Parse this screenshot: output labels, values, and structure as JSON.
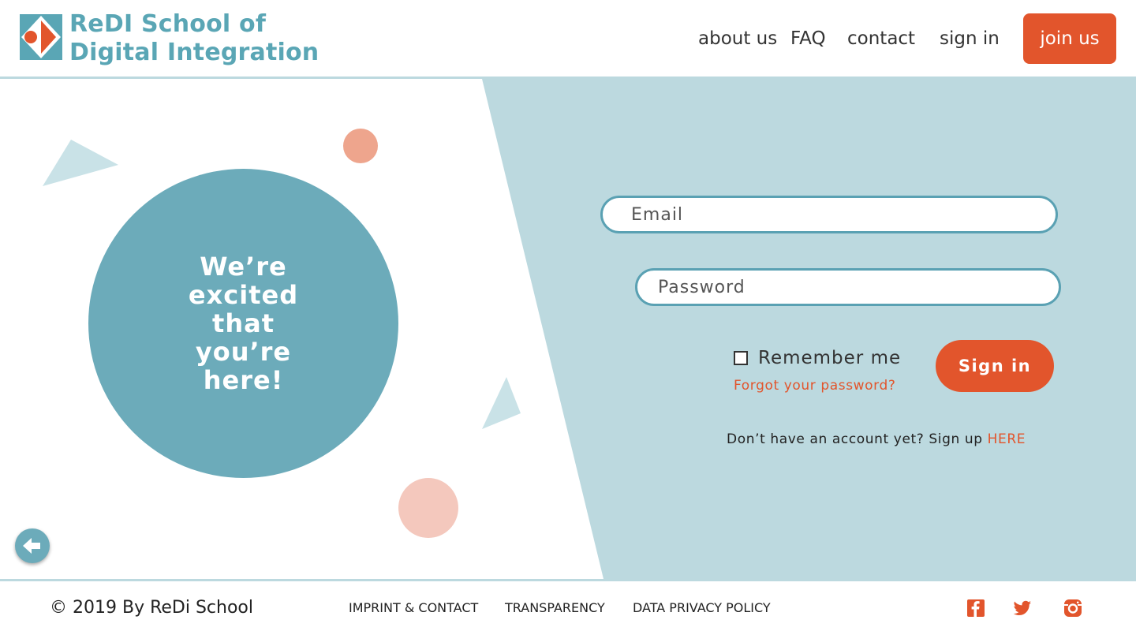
{
  "header": {
    "logo_line1": "ReDI School of",
    "logo_line2": "Digital Integration",
    "nav": {
      "about": "about us",
      "faq": "FAQ",
      "contact": "contact",
      "signin": "sign in",
      "join": "join us"
    }
  },
  "hero": {
    "text": "We’re excited that you’re here!"
  },
  "form": {
    "email_placeholder": "Email",
    "password_placeholder": "Password",
    "remember_label": "Remember me",
    "forgot_link": "Forgot your password?",
    "submit_label": "Sign in",
    "signup_prompt": "Don’t have an account yet? Sign up",
    "signup_link": "HERE"
  },
  "footer": {
    "copyright": "© 2019 By ReDi School",
    "links": {
      "imprint": "IMPRINT & CONTACT",
      "transparency": "TRANSPARENCY",
      "privacy": "DATA PRIVACY POLICY"
    },
    "social": [
      "facebook-icon",
      "twitter-icon",
      "instagram-icon"
    ]
  },
  "colors": {
    "accent_orange": "#e2552c",
    "teal": "#6cabba",
    "light_teal": "#bcd9df",
    "logo_teal": "#5aa6b5"
  }
}
